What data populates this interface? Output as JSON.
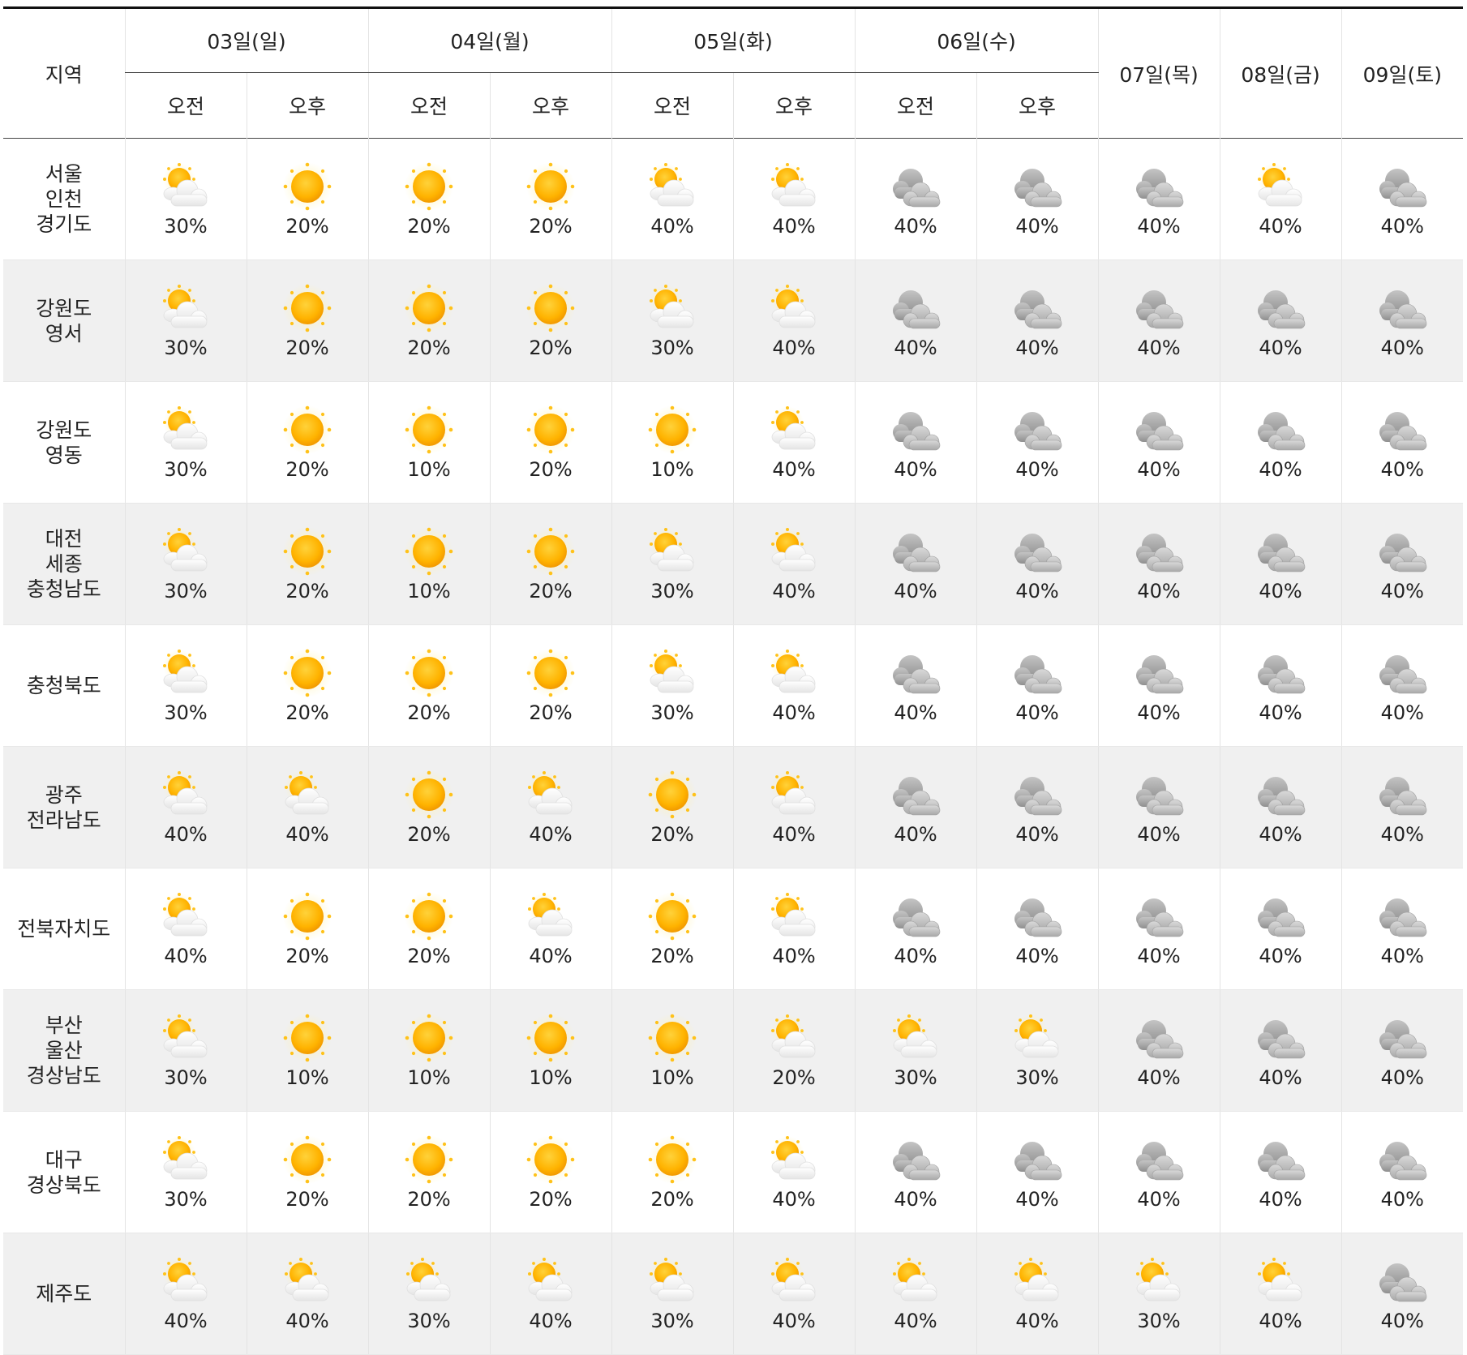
{
  "header": {
    "region_label": "지역",
    "days": [
      "03일(일)",
      "04일(월)",
      "05일(화)",
      "06일(수)",
      "07일(목)",
      "08일(금)",
      "09일(토)"
    ],
    "am": "오전",
    "pm": "오후"
  },
  "colors": {
    "sun": "#ffb000",
    "cloud": "#f2f2f2",
    "dark_cloud": "#b8b8b8",
    "alt_row": "#f0f0f0"
  },
  "icons": {
    "sunny": "sun-icon",
    "partly": "partly-cloudy-icon",
    "cloudy": "cloudy-icon"
  },
  "rows": [
    {
      "region": [
        "서울",
        "인천",
        "경기도"
      ],
      "cells": [
        [
          "partly",
          "30%"
        ],
        [
          "sunny",
          "20%"
        ],
        [
          "sunny",
          "20%"
        ],
        [
          "sunny",
          "20%"
        ],
        [
          "partly",
          "40%"
        ],
        [
          "partly",
          "40%"
        ],
        [
          "cloudy",
          "40%"
        ],
        [
          "cloudy",
          "40%"
        ],
        [
          "cloudy",
          "40%"
        ],
        [
          "partly",
          "40%"
        ],
        [
          "cloudy",
          "40%"
        ]
      ]
    },
    {
      "region": [
        "강원도",
        "영서"
      ],
      "cells": [
        [
          "partly",
          "30%"
        ],
        [
          "sunny",
          "20%"
        ],
        [
          "sunny",
          "20%"
        ],
        [
          "sunny",
          "20%"
        ],
        [
          "partly",
          "30%"
        ],
        [
          "partly",
          "40%"
        ],
        [
          "cloudy",
          "40%"
        ],
        [
          "cloudy",
          "40%"
        ],
        [
          "cloudy",
          "40%"
        ],
        [
          "cloudy",
          "40%"
        ],
        [
          "cloudy",
          "40%"
        ]
      ]
    },
    {
      "region": [
        "강원도",
        "영동"
      ],
      "cells": [
        [
          "partly",
          "30%"
        ],
        [
          "sunny",
          "20%"
        ],
        [
          "sunny",
          "10%"
        ],
        [
          "sunny",
          "20%"
        ],
        [
          "sunny",
          "10%"
        ],
        [
          "partly",
          "40%"
        ],
        [
          "cloudy",
          "40%"
        ],
        [
          "cloudy",
          "40%"
        ],
        [
          "cloudy",
          "40%"
        ],
        [
          "cloudy",
          "40%"
        ],
        [
          "cloudy",
          "40%"
        ]
      ]
    },
    {
      "region": [
        "대전",
        "세종",
        "충청남도"
      ],
      "cells": [
        [
          "partly",
          "30%"
        ],
        [
          "sunny",
          "20%"
        ],
        [
          "sunny",
          "10%"
        ],
        [
          "sunny",
          "20%"
        ],
        [
          "partly",
          "30%"
        ],
        [
          "partly",
          "40%"
        ],
        [
          "cloudy",
          "40%"
        ],
        [
          "cloudy",
          "40%"
        ],
        [
          "cloudy",
          "40%"
        ],
        [
          "cloudy",
          "40%"
        ],
        [
          "cloudy",
          "40%"
        ]
      ]
    },
    {
      "region": [
        "충청북도"
      ],
      "cells": [
        [
          "partly",
          "30%"
        ],
        [
          "sunny",
          "20%"
        ],
        [
          "sunny",
          "20%"
        ],
        [
          "sunny",
          "20%"
        ],
        [
          "partly",
          "30%"
        ],
        [
          "partly",
          "40%"
        ],
        [
          "cloudy",
          "40%"
        ],
        [
          "cloudy",
          "40%"
        ],
        [
          "cloudy",
          "40%"
        ],
        [
          "cloudy",
          "40%"
        ],
        [
          "cloudy",
          "40%"
        ]
      ]
    },
    {
      "region": [
        "광주",
        "전라남도"
      ],
      "cells": [
        [
          "partly",
          "40%"
        ],
        [
          "partly",
          "40%"
        ],
        [
          "sunny",
          "20%"
        ],
        [
          "partly",
          "40%"
        ],
        [
          "sunny",
          "20%"
        ],
        [
          "partly",
          "40%"
        ],
        [
          "cloudy",
          "40%"
        ],
        [
          "cloudy",
          "40%"
        ],
        [
          "cloudy",
          "40%"
        ],
        [
          "cloudy",
          "40%"
        ],
        [
          "cloudy",
          "40%"
        ]
      ]
    },
    {
      "region": [
        "전북자치도"
      ],
      "cells": [
        [
          "partly",
          "40%"
        ],
        [
          "sunny",
          "20%"
        ],
        [
          "sunny",
          "20%"
        ],
        [
          "partly",
          "40%"
        ],
        [
          "sunny",
          "20%"
        ],
        [
          "partly",
          "40%"
        ],
        [
          "cloudy",
          "40%"
        ],
        [
          "cloudy",
          "40%"
        ],
        [
          "cloudy",
          "40%"
        ],
        [
          "cloudy",
          "40%"
        ],
        [
          "cloudy",
          "40%"
        ]
      ]
    },
    {
      "region": [
        "부산",
        "울산",
        "경상남도"
      ],
      "cells": [
        [
          "partly",
          "30%"
        ],
        [
          "sunny",
          "10%"
        ],
        [
          "sunny",
          "10%"
        ],
        [
          "sunny",
          "10%"
        ],
        [
          "sunny",
          "10%"
        ],
        [
          "partly",
          "20%"
        ],
        [
          "partly",
          "30%"
        ],
        [
          "partly",
          "30%"
        ],
        [
          "cloudy",
          "40%"
        ],
        [
          "cloudy",
          "40%"
        ],
        [
          "cloudy",
          "40%"
        ]
      ]
    },
    {
      "region": [
        "대구",
        "경상북도"
      ],
      "cells": [
        [
          "partly",
          "30%"
        ],
        [
          "sunny",
          "20%"
        ],
        [
          "sunny",
          "20%"
        ],
        [
          "sunny",
          "20%"
        ],
        [
          "sunny",
          "20%"
        ],
        [
          "partly",
          "40%"
        ],
        [
          "cloudy",
          "40%"
        ],
        [
          "cloudy",
          "40%"
        ],
        [
          "cloudy",
          "40%"
        ],
        [
          "cloudy",
          "40%"
        ],
        [
          "cloudy",
          "40%"
        ]
      ]
    },
    {
      "region": [
        "제주도"
      ],
      "cells": [
        [
          "partly",
          "40%"
        ],
        [
          "partly",
          "40%"
        ],
        [
          "partly",
          "30%"
        ],
        [
          "partly",
          "40%"
        ],
        [
          "partly",
          "30%"
        ],
        [
          "partly",
          "40%"
        ],
        [
          "partly",
          "40%"
        ],
        [
          "partly",
          "40%"
        ],
        [
          "partly",
          "30%"
        ],
        [
          "partly",
          "40%"
        ],
        [
          "cloudy",
          "40%"
        ]
      ]
    }
  ]
}
